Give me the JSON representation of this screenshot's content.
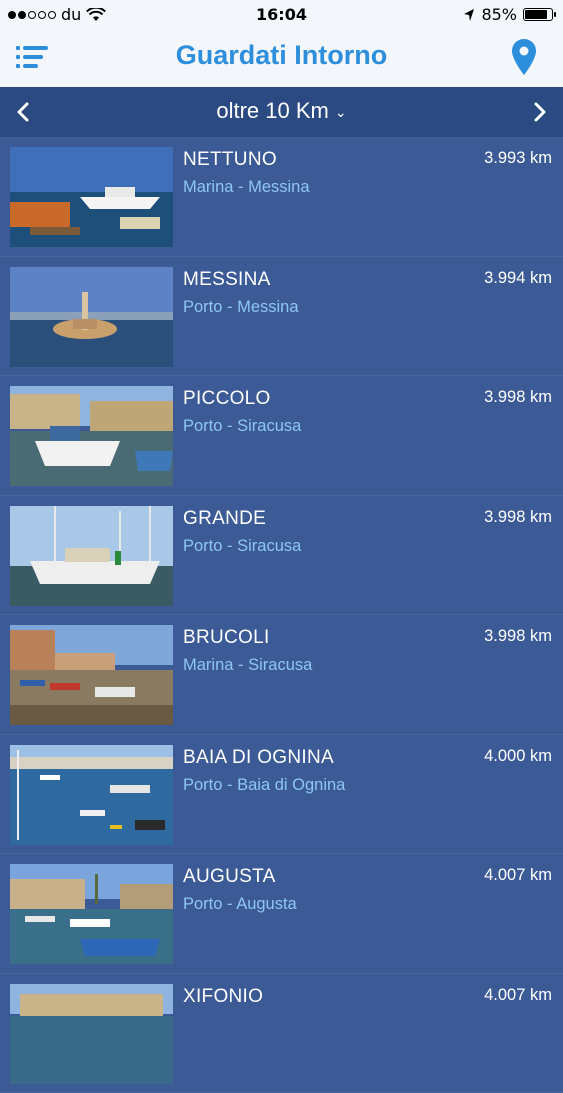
{
  "status_bar": {
    "carrier": "du",
    "time": "16:04",
    "battery": "85%",
    "battery_level": 0.85
  },
  "header": {
    "title": "Guardati Intorno",
    "menu_icon": "list-menu-icon",
    "location_icon": "map-pin-icon"
  },
  "filter": {
    "label": "oltre 10 Km",
    "dropdown_icon": "chevron-down-icon",
    "prev_icon": "chevron-left-icon",
    "next_icon": "chevron-right-icon"
  },
  "colors": {
    "background": "#3b5a96",
    "filter_bar": "#2c4a82",
    "title": "#2d8fdc",
    "subtitle": "#8ec7f2"
  },
  "places": [
    {
      "name": "NETTUNO",
      "subtitle": "Marina - Messina",
      "distance": "3.993 km"
    },
    {
      "name": "MESSINA",
      "subtitle": "Porto - Messina",
      "distance": "3.994 km"
    },
    {
      "name": "PICCOLO",
      "subtitle": "Porto - Siracusa",
      "distance": "3.998 km"
    },
    {
      "name": "GRANDE",
      "subtitle": "Porto - Siracusa",
      "distance": "3.998 km"
    },
    {
      "name": "BRUCOLI",
      "subtitle": "Marina - Siracusa",
      "distance": "3.998 km"
    },
    {
      "name": "BAIA DI OGNINA",
      "subtitle": "Porto - Baia di Ognina",
      "distance": "4.000 km"
    },
    {
      "name": "AUGUSTA",
      "subtitle": "Porto - Augusta",
      "distance": "4.007 km"
    },
    {
      "name": "XIFONIO",
      "subtitle": "",
      "distance": "4.007 km"
    }
  ]
}
